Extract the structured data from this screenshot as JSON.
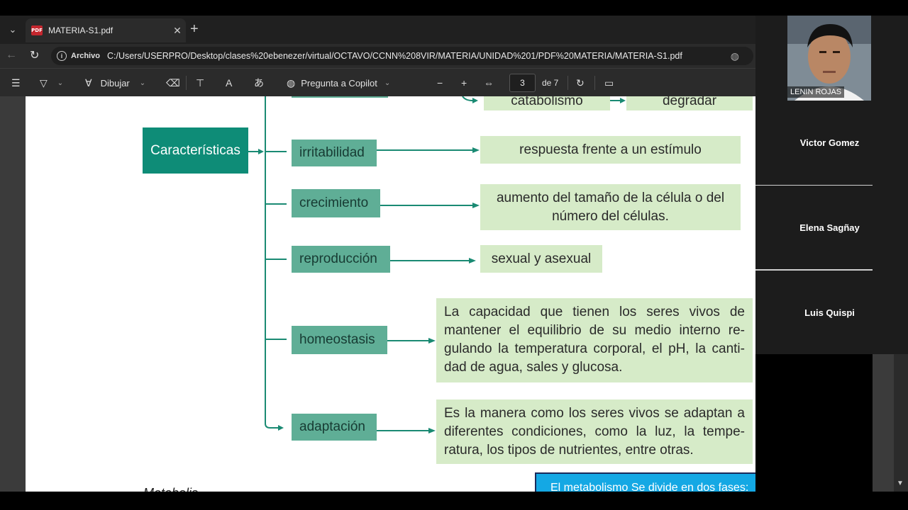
{
  "browser": {
    "tab_title": "MATERIA-S1.pdf",
    "address_label": "Archivo",
    "url": "C:/Users/USERPRO/Desktop/clases%20ebenezer/virtual/OCTAVO/CCNN%208VIR/MATERIA/UNIDAD%201/PDF%20MATERIA/MATERIA-S1.pdf"
  },
  "pdf_toolbar": {
    "draw_label": "Dibujar",
    "copilot_label": "Pregunta a Copilot",
    "page_current": "3",
    "page_total": "de 7"
  },
  "document": {
    "heading": "Características",
    "nodes": [
      {
        "label": "irritabilidad",
        "description": "respuesta frente a un estímulo"
      },
      {
        "label": "crecimiento",
        "description": "aumento del tamaño de la célula o del número del células."
      },
      {
        "label": "reproducción",
        "description": "sexual y asexual"
      },
      {
        "label": "homeostasis",
        "description": "La capacidad que tienen los seres vivos de mantener el equilibrio de su medio interno re-gulando la temperatura corporal, el pH, la canti-dad de agua, sales y glucosa."
      },
      {
        "label": "adaptación",
        "description": "Es la manera como los seres vivos se adaptan a diferentes condiciones, como la luz, la tempe-ratura, los tipos de nutrientes, entre otras."
      }
    ],
    "top_partial": [
      "catabolismo",
      "degradar"
    ],
    "bottom_box": "El metabolismo Se divide en dos fases:",
    "bottom_peek": "Metabolis"
  },
  "participants": [
    {
      "name": "LENIN ROJAS",
      "video": true
    },
    {
      "name": "Victor Gomez",
      "video": false
    },
    {
      "name": "Elena Sagñay",
      "video": false
    },
    {
      "name": "Luis Quispi",
      "video": false
    }
  ],
  "colors": {
    "heading_bg": "#0e8c77",
    "node_bg": "#5fae96",
    "desc_bg": "#d6ebc8",
    "connector": "#1a8a73",
    "blue_box": "#14a8e4"
  }
}
